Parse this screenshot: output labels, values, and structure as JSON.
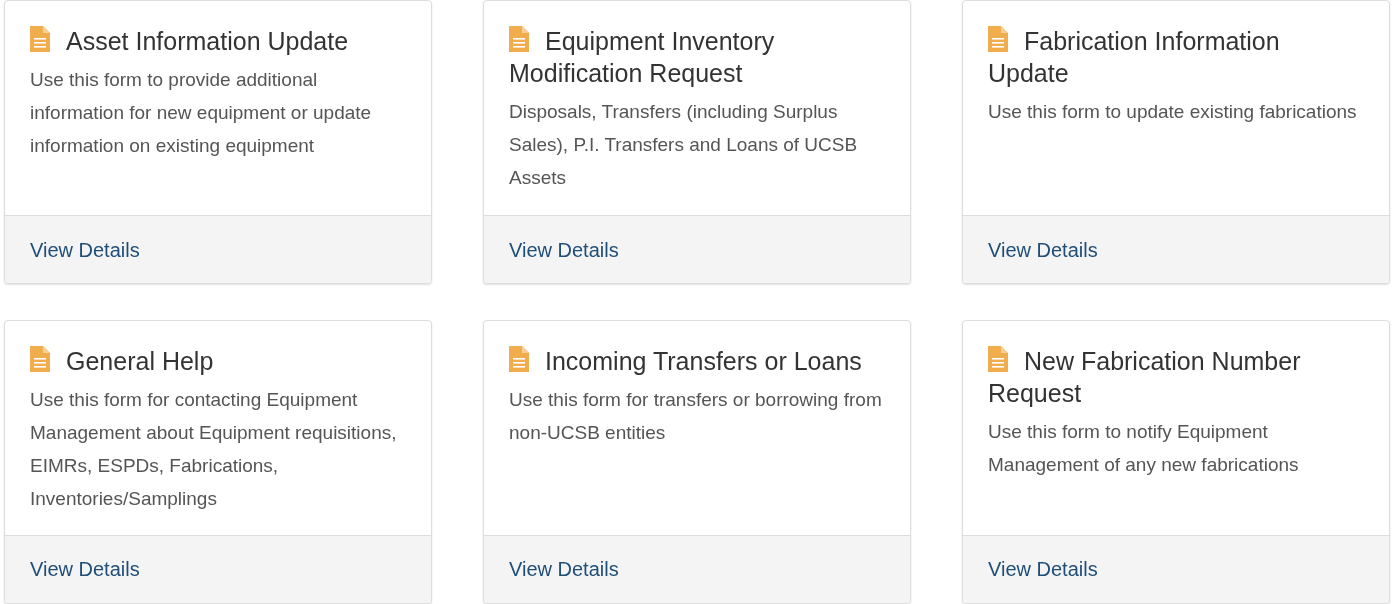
{
  "cards": [
    {
      "title": "Asset Information Update",
      "description": "Use this form to provide additional information for new equipment or update information on existing equipment",
      "link": "View Details"
    },
    {
      "title": "Equipment Inventory Modification Request",
      "description": "Disposals, Transfers (including Surplus Sales), P.I. Transfers and Loans of UCSB Assets",
      "link": "View Details"
    },
    {
      "title": "Fabrication Information Update",
      "description": "Use this form to update existing fabrications",
      "link": "View Details"
    },
    {
      "title": "General Help",
      "description": "Use this form for contacting Equipment Management about Equipment requisitions, EIMRs, ESPDs, Fabrications, Inventories/Samplings",
      "link": "View Details"
    },
    {
      "title": "Incoming Transfers or Loans",
      "description": "Use this form for transfers or borrowing from non-UCSB entities",
      "link": "View Details"
    },
    {
      "title": "New Fabrication Number Request",
      "description": "Use this form to notify Equipment Management of any new fabrications",
      "link": "View Details"
    }
  ]
}
